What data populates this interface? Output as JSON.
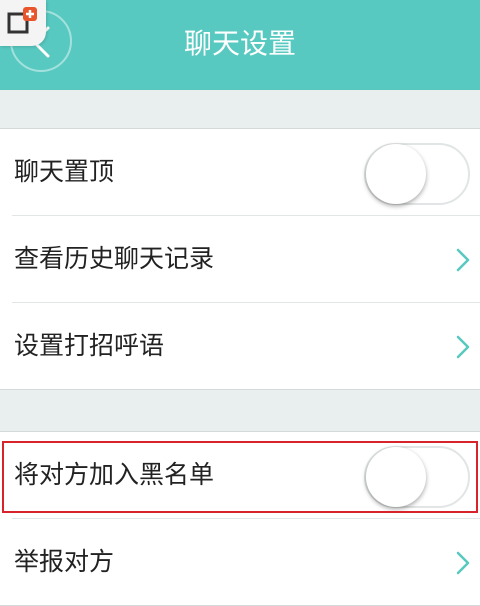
{
  "header": {
    "title": "聊天设置",
    "back_icon": "chevron-left-icon",
    "corner_icon": "add-window-icon",
    "bg_color": "#58c9c1"
  },
  "sections": [
    {
      "rows": [
        {
          "label": "聊天置顶",
          "control": "toggle",
          "state": "off"
        },
        {
          "label": "查看历史聊天记录",
          "control": "chevron"
        },
        {
          "label": "设置打招呼语",
          "control": "chevron"
        }
      ]
    },
    {
      "rows": [
        {
          "label": "将对方加入黑名单",
          "control": "toggle",
          "state": "off",
          "highlighted": true
        },
        {
          "label": "举报对方",
          "control": "chevron"
        }
      ]
    }
  ],
  "colors": {
    "accent": "#58c9c1",
    "highlight": "#d9232b",
    "background": "#e9eeee"
  }
}
